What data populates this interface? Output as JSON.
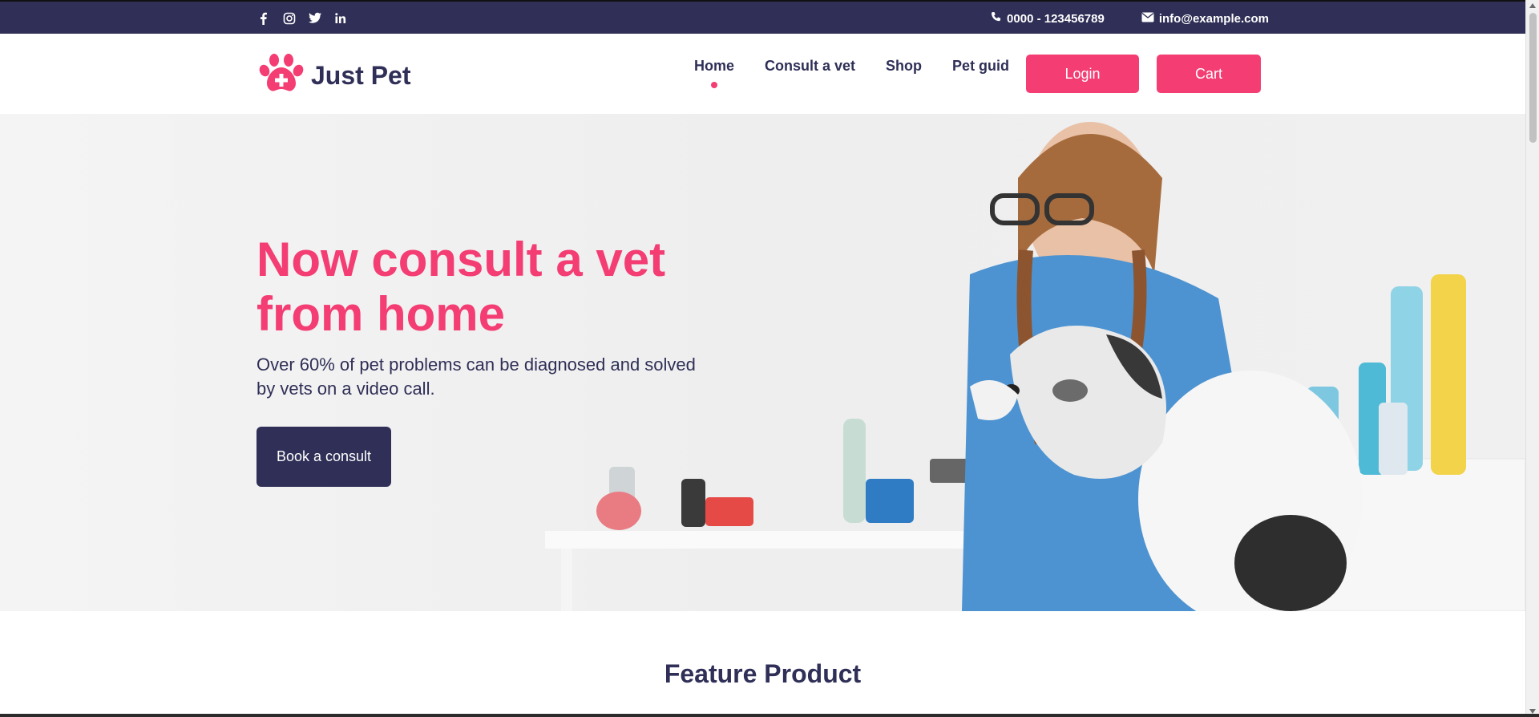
{
  "topbar": {
    "social_icons": [
      "facebook-icon",
      "instagram-icon",
      "twitter-icon",
      "linkedin-icon"
    ],
    "phone": "0000 - 123456789",
    "email": "info@example.com"
  },
  "header": {
    "logo_text": "Just Pet",
    "nav": [
      "Home",
      "Consult a vet",
      "Shop",
      "Pet guid"
    ],
    "active_nav": "Home",
    "login_label": "Login",
    "cart_label": "Cart"
  },
  "hero": {
    "title": "Now consult a vet from home",
    "subtitle": "Over 60% of pet problems can be diagnosed and solved by vets on a video call.",
    "cta_label": "Book a consult"
  },
  "feature": {
    "title": "Feature Product"
  },
  "colors": {
    "brand_pink": "#f33d73",
    "navy": "#2f2f57",
    "white": "#ffffff"
  }
}
